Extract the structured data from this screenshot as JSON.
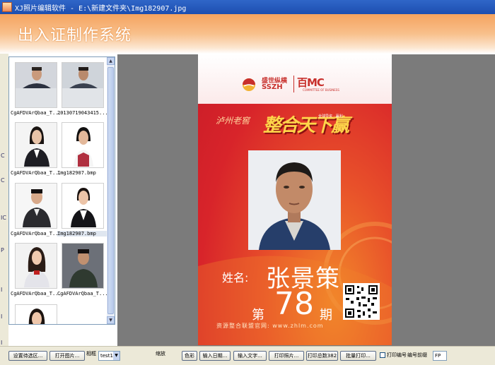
{
  "window": {
    "title": "XJ照片编辑软件 - E:\\新建文件夹\\Img182907.jpg"
  },
  "header": {
    "title": "出入证制作系统"
  },
  "left_gutter_letters": [
    "C",
    "C",
    "IC",
    "P",
    "I",
    "I",
    "I"
  ],
  "thumbnails": [
    {
      "caption": "CgAFDVArQbaa_T...",
      "selected": false
    },
    {
      "caption": "20130719043415...",
      "selected": false
    },
    {
      "caption": "CgAFDVArQbaa_T...",
      "selected": false
    },
    {
      "caption": "Img182907.bmp",
      "selected": false
    },
    {
      "caption": "CgAFDVArQbaa_T...",
      "selected": false
    },
    {
      "caption": "Img182907.bmp",
      "selected": true
    },
    {
      "caption": "CgAFDVArQbaa_T...",
      "selected": false
    },
    {
      "caption": "CgAFDVArQbaa_T...",
      "selected": false
    },
    {
      "caption": "",
      "selected": false
    }
  ],
  "card": {
    "logo_ss_line1": "盛世纵横",
    "logo_ss_line2": "SSZH",
    "logo_bm": "百MC",
    "logo_bm_sub": "COMMITTEE OF BUSINESS",
    "slogan_small": "泸州老窖",
    "slogan_big": "整合天下赢",
    "slogan_tag": "全球导资 · 赢利",
    "name_label": "姓名:",
    "name_value": "张景策",
    "period_pre": "第",
    "period_number": "78",
    "period_post": "期",
    "website": "资源整合联盟官网: www.zhlm.com"
  },
  "toolbar": {
    "set_dir_btn": "设置待选区...",
    "open_image_btn": "打开图片...",
    "frame_label": "相框",
    "frame_select": "test1",
    "zoom_label": "缩放",
    "color_btn": "色彩",
    "input_date_btn": "输入日期...",
    "input_text_btn": "输入文字...",
    "print_photo_btn": "打印照片...",
    "print_total_btn": "打印总数382",
    "batch_print_btn": "批量打印...",
    "print_number_label": "打印编号",
    "number_prefix_label": "编号前缀",
    "number_prefix_value": "FP"
  },
  "colors": {
    "titlebar": "#1d4eb0",
    "header_orange": "#f5a35f",
    "card_red": "#d8242a",
    "card_orange": "#f2892a",
    "preview_bg": "#7b7b7b",
    "toolbar_bg": "#ece9d8"
  }
}
